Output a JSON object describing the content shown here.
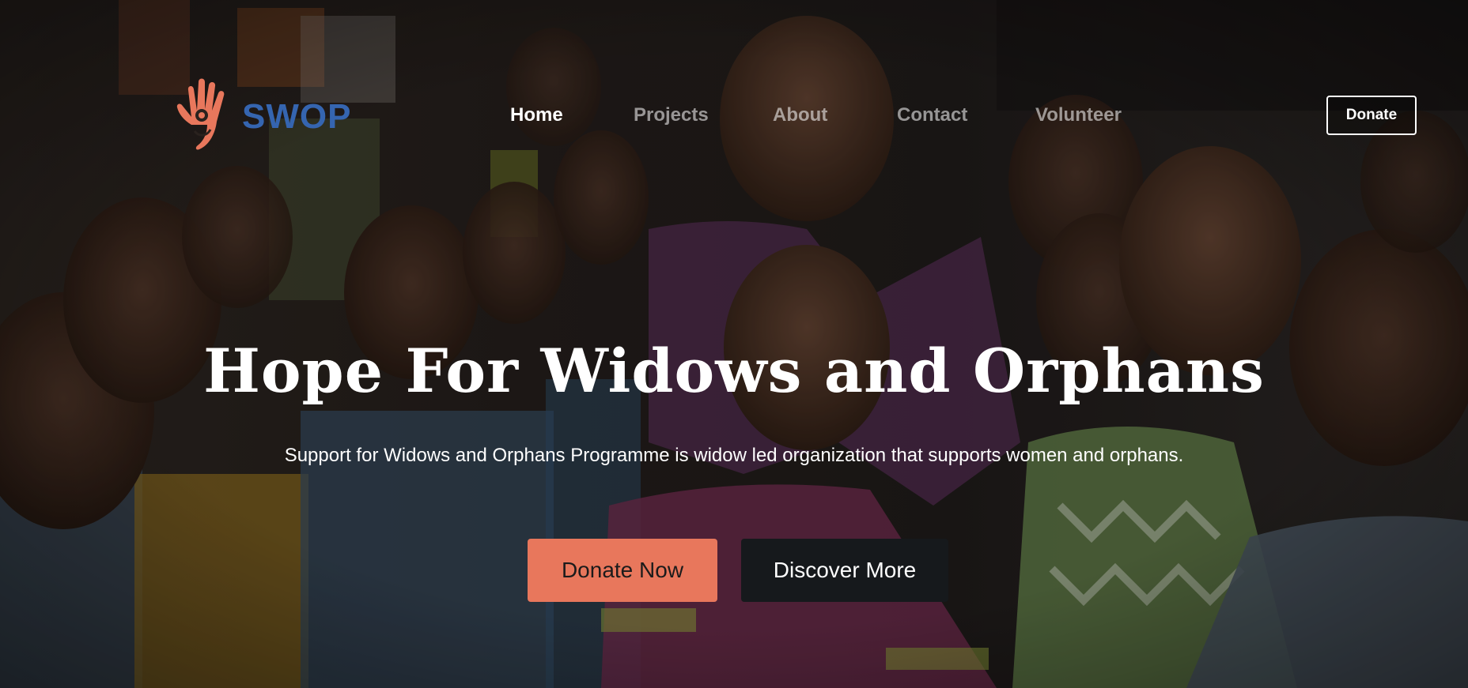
{
  "brand": {
    "name": "SWOP",
    "logo_icon": "hand-logo-icon",
    "logo_color": "#e8775c",
    "name_color": "#3565b0"
  },
  "nav": {
    "links": [
      {
        "label": "Home",
        "active": true
      },
      {
        "label": "Projects",
        "active": false
      },
      {
        "label": "About",
        "active": false
      },
      {
        "label": "Contact",
        "active": false
      },
      {
        "label": "Volunteer",
        "active": false
      }
    ],
    "donate_label": "Donate"
  },
  "hero": {
    "title": "Hope For Widows and Orphans",
    "subtitle": "Support for Widows and Orphans Programme is widow led organization that supports women and orphans.",
    "primary_cta": "Donate Now",
    "secondary_cta": "Discover More",
    "background": "photo-of-children-group"
  },
  "colors": {
    "accent": "#e8775c",
    "dark_button": "#16191c",
    "text": "#ffffff"
  }
}
